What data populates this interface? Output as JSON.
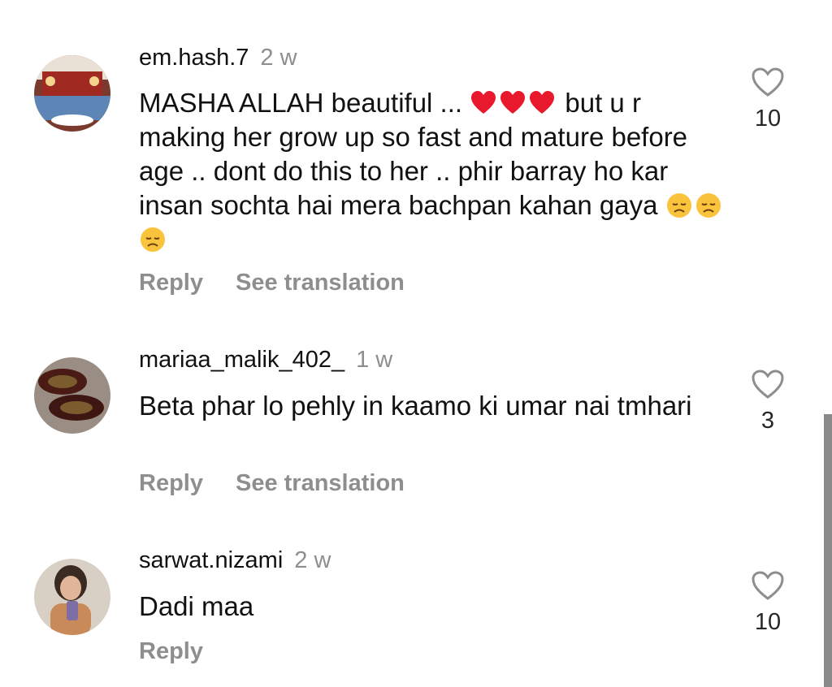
{
  "comments": [
    {
      "username": "em.hash.7",
      "time": "2 w",
      "text_part1": "MASHA ALLAH beautiful ... ",
      "text_part2": " but u r making her grow up so fast and mature before age .. dont do this to her .. phir barray ho kar insan sochta hai mera bachpan kahan gaya ",
      "reply": "Reply",
      "translate": "See translation",
      "likes": "10",
      "emojis_heart": "heart-emoji",
      "emojis_sad": "disappointed-face-emoji"
    },
    {
      "username": "mariaa_malik_402_",
      "time": "1 w",
      "text": "Beta phar lo pehly in kaamo ki umar nai tmhari",
      "reply": "Reply",
      "translate": "See translation",
      "likes": "3"
    },
    {
      "username": "sarwat.nizami",
      "time": "2 w",
      "text": "Dadi maa",
      "reply": "Reply",
      "likes": "10"
    }
  ],
  "colors": {
    "secondary_text": "#8e8e8e",
    "heart_red": "#e8192c",
    "emoji_yellow": "#f9c33c"
  }
}
